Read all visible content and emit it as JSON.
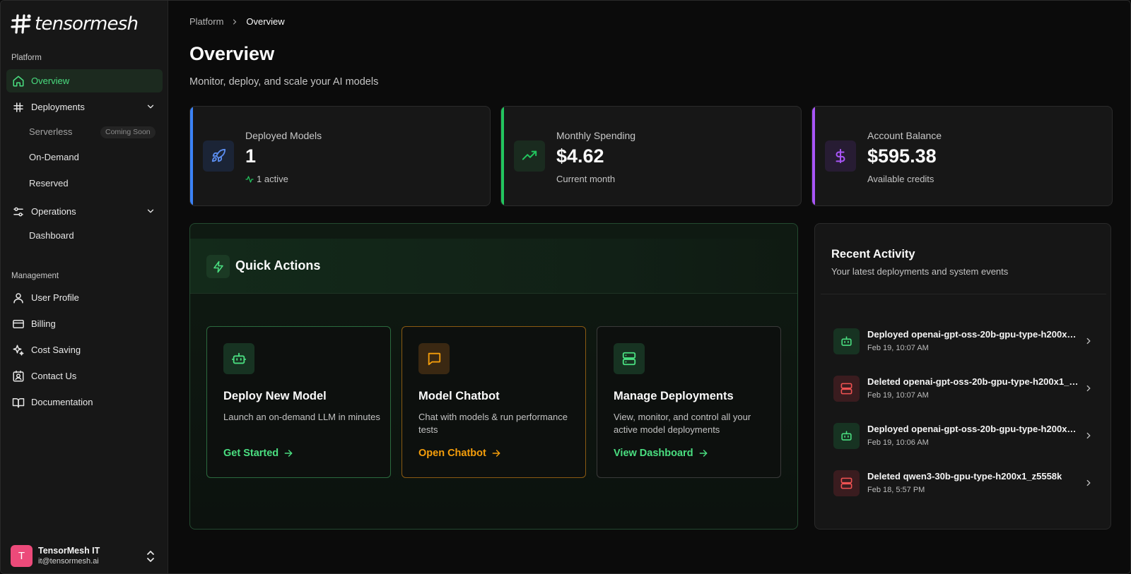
{
  "brand": {
    "name": "tensormesh"
  },
  "sidebar": {
    "platform_label": "Platform",
    "management_label": "Management",
    "overview": "Overview",
    "deployments": "Deployments",
    "deployments_sub": {
      "serverless": "Serverless",
      "coming_soon": "Coming Soon",
      "on_demand": "On-Demand",
      "reserved": "Reserved"
    },
    "operations": "Operations",
    "operations_sub": {
      "dashboard": "Dashboard"
    },
    "management_items": {
      "user_profile": "User Profile",
      "billing": "Billing",
      "cost_saving": "Cost Saving",
      "contact_us": "Contact Us",
      "documentation": "Documentation"
    },
    "user": {
      "initial": "T",
      "name": "TensorMesh IT",
      "email": "it@tensormesh.ai"
    }
  },
  "breadcrumb": {
    "parent": "Platform",
    "current": "Overview"
  },
  "page": {
    "title": "Overview",
    "subtitle": "Monitor, deploy, and scale your AI models"
  },
  "stats": {
    "deployed": {
      "label": "Deployed Models",
      "value": "1",
      "sub": "1 active",
      "accent": "#3b82f6"
    },
    "spending": {
      "label": "Monthly Spending",
      "value": "$4.62",
      "sub": "Current month",
      "accent": "#22c55e"
    },
    "balance": {
      "label": "Account Balance",
      "value": "$595.38",
      "sub": "Available credits",
      "accent": "#a855f7"
    }
  },
  "quick_actions": {
    "title": "Quick Actions",
    "deploy": {
      "title": "Deploy New Model",
      "desc": "Launch an on-demand LLM in minutes",
      "link": "Get Started",
      "color": "#4ade80"
    },
    "chatbot": {
      "title": "Model Chatbot",
      "desc": "Chat with models & run performance tests",
      "link": "Open Chatbot",
      "color": "#f59e0b"
    },
    "manage": {
      "title": "Manage Deployments",
      "desc": "View, monitor, and control all your active model deployments",
      "link": "View Dashboard",
      "color": "#4ade80"
    }
  },
  "recent_activity": {
    "title": "Recent Activity",
    "subtitle": "Your latest deployments and system events",
    "items": [
      {
        "name": "Deployed openai-gpt-oss-20b-gpu-type-h200x1_…",
        "time": "Feb 19, 10:07 AM"
      },
      {
        "name": "Deleted openai-gpt-oss-20b-gpu-type-h200x1_ul…",
        "time": "Feb 19, 10:07 AM"
      },
      {
        "name": "Deployed openai-gpt-oss-20b-gpu-type-h200x1_…",
        "time": "Feb 19, 10:06 AM"
      },
      {
        "name": "Deleted qwen3-30b-gpu-type-h200x1_z5558k",
        "time": "Feb 18, 5:57 PM"
      }
    ]
  }
}
